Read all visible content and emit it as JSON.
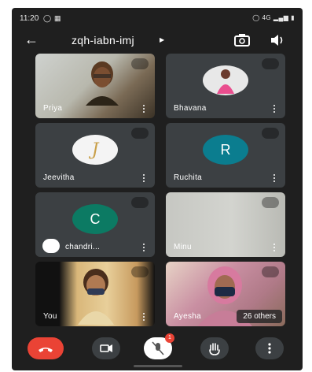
{
  "status_bar": {
    "time": "11:20",
    "right": "4G"
  },
  "meeting": {
    "code": "zqh-iabn-imj"
  },
  "tiles": [
    {
      "name": "Priya"
    },
    {
      "name": "Bhavana"
    },
    {
      "name": "Jeevitha",
      "avatar_letter": "J"
    },
    {
      "name": "Ruchita",
      "avatar_letter": "R"
    },
    {
      "name": "chandri...",
      "avatar_letter": "C"
    },
    {
      "name": "Minu"
    },
    {
      "name": "You"
    },
    {
      "name": "Ayesha",
      "others": "26 others"
    }
  ],
  "controls": {
    "mic_badge": "1"
  },
  "colors": {
    "ruchita": "#0b7d8f",
    "chandri": "#0c7a63",
    "end_call": "#ea4335"
  }
}
